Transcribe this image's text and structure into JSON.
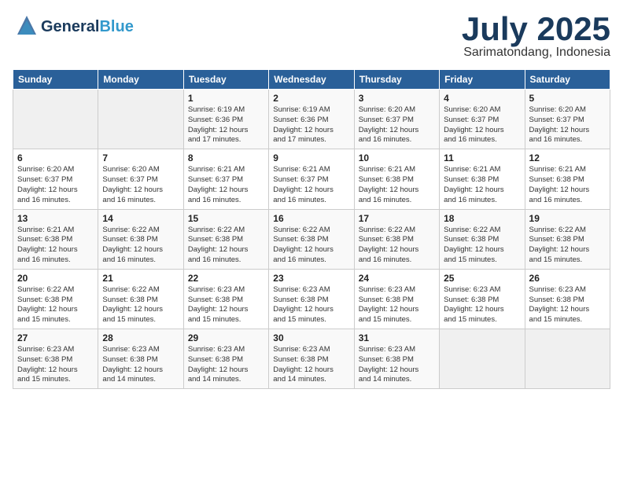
{
  "header": {
    "logo": {
      "line1": "General",
      "line2": "Blue",
      "tagline": ""
    },
    "title": "July 2025",
    "location": "Sarimatondang, Indonesia"
  },
  "weekdays": [
    "Sunday",
    "Monday",
    "Tuesday",
    "Wednesday",
    "Thursday",
    "Friday",
    "Saturday"
  ],
  "weeks": [
    [
      {
        "day": "",
        "info": ""
      },
      {
        "day": "",
        "info": ""
      },
      {
        "day": "1",
        "info": "Sunrise: 6:19 AM\nSunset: 6:36 PM\nDaylight: 12 hours\nand 17 minutes."
      },
      {
        "day": "2",
        "info": "Sunrise: 6:19 AM\nSunset: 6:36 PM\nDaylight: 12 hours\nand 17 minutes."
      },
      {
        "day": "3",
        "info": "Sunrise: 6:20 AM\nSunset: 6:37 PM\nDaylight: 12 hours\nand 16 minutes."
      },
      {
        "day": "4",
        "info": "Sunrise: 6:20 AM\nSunset: 6:37 PM\nDaylight: 12 hours\nand 16 minutes."
      },
      {
        "day": "5",
        "info": "Sunrise: 6:20 AM\nSunset: 6:37 PM\nDaylight: 12 hours\nand 16 minutes."
      }
    ],
    [
      {
        "day": "6",
        "info": "Sunrise: 6:20 AM\nSunset: 6:37 PM\nDaylight: 12 hours\nand 16 minutes."
      },
      {
        "day": "7",
        "info": "Sunrise: 6:20 AM\nSunset: 6:37 PM\nDaylight: 12 hours\nand 16 minutes."
      },
      {
        "day": "8",
        "info": "Sunrise: 6:21 AM\nSunset: 6:37 PM\nDaylight: 12 hours\nand 16 minutes."
      },
      {
        "day": "9",
        "info": "Sunrise: 6:21 AM\nSunset: 6:37 PM\nDaylight: 12 hours\nand 16 minutes."
      },
      {
        "day": "10",
        "info": "Sunrise: 6:21 AM\nSunset: 6:38 PM\nDaylight: 12 hours\nand 16 minutes."
      },
      {
        "day": "11",
        "info": "Sunrise: 6:21 AM\nSunset: 6:38 PM\nDaylight: 12 hours\nand 16 minutes."
      },
      {
        "day": "12",
        "info": "Sunrise: 6:21 AM\nSunset: 6:38 PM\nDaylight: 12 hours\nand 16 minutes."
      }
    ],
    [
      {
        "day": "13",
        "info": "Sunrise: 6:21 AM\nSunset: 6:38 PM\nDaylight: 12 hours\nand 16 minutes."
      },
      {
        "day": "14",
        "info": "Sunrise: 6:22 AM\nSunset: 6:38 PM\nDaylight: 12 hours\nand 16 minutes."
      },
      {
        "day": "15",
        "info": "Sunrise: 6:22 AM\nSunset: 6:38 PM\nDaylight: 12 hours\nand 16 minutes."
      },
      {
        "day": "16",
        "info": "Sunrise: 6:22 AM\nSunset: 6:38 PM\nDaylight: 12 hours\nand 16 minutes."
      },
      {
        "day": "17",
        "info": "Sunrise: 6:22 AM\nSunset: 6:38 PM\nDaylight: 12 hours\nand 16 minutes."
      },
      {
        "day": "18",
        "info": "Sunrise: 6:22 AM\nSunset: 6:38 PM\nDaylight: 12 hours\nand 15 minutes."
      },
      {
        "day": "19",
        "info": "Sunrise: 6:22 AM\nSunset: 6:38 PM\nDaylight: 12 hours\nand 15 minutes."
      }
    ],
    [
      {
        "day": "20",
        "info": "Sunrise: 6:22 AM\nSunset: 6:38 PM\nDaylight: 12 hours\nand 15 minutes."
      },
      {
        "day": "21",
        "info": "Sunrise: 6:22 AM\nSunset: 6:38 PM\nDaylight: 12 hours\nand 15 minutes."
      },
      {
        "day": "22",
        "info": "Sunrise: 6:23 AM\nSunset: 6:38 PM\nDaylight: 12 hours\nand 15 minutes."
      },
      {
        "day": "23",
        "info": "Sunrise: 6:23 AM\nSunset: 6:38 PM\nDaylight: 12 hours\nand 15 minutes."
      },
      {
        "day": "24",
        "info": "Sunrise: 6:23 AM\nSunset: 6:38 PM\nDaylight: 12 hours\nand 15 minutes."
      },
      {
        "day": "25",
        "info": "Sunrise: 6:23 AM\nSunset: 6:38 PM\nDaylight: 12 hours\nand 15 minutes."
      },
      {
        "day": "26",
        "info": "Sunrise: 6:23 AM\nSunset: 6:38 PM\nDaylight: 12 hours\nand 15 minutes."
      }
    ],
    [
      {
        "day": "27",
        "info": "Sunrise: 6:23 AM\nSunset: 6:38 PM\nDaylight: 12 hours\nand 15 minutes."
      },
      {
        "day": "28",
        "info": "Sunrise: 6:23 AM\nSunset: 6:38 PM\nDaylight: 12 hours\nand 14 minutes."
      },
      {
        "day": "29",
        "info": "Sunrise: 6:23 AM\nSunset: 6:38 PM\nDaylight: 12 hours\nand 14 minutes."
      },
      {
        "day": "30",
        "info": "Sunrise: 6:23 AM\nSunset: 6:38 PM\nDaylight: 12 hours\nand 14 minutes."
      },
      {
        "day": "31",
        "info": "Sunrise: 6:23 AM\nSunset: 6:38 PM\nDaylight: 12 hours\nand 14 minutes."
      },
      {
        "day": "",
        "info": ""
      },
      {
        "day": "",
        "info": ""
      }
    ]
  ]
}
